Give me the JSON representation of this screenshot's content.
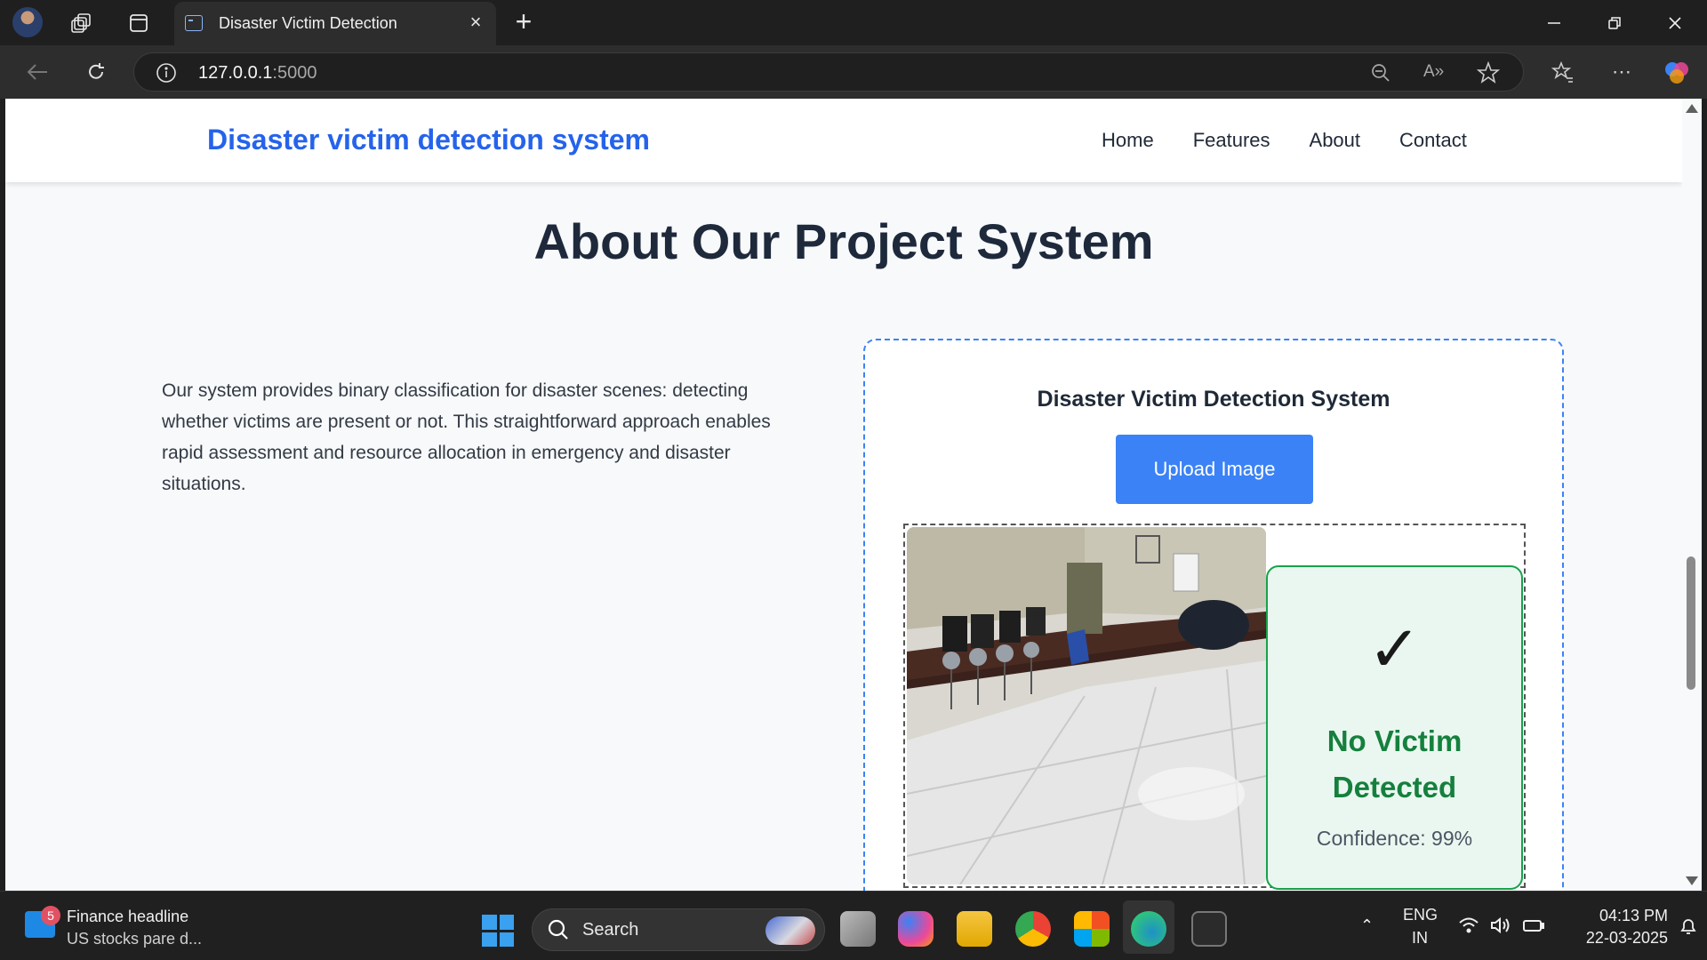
{
  "browser": {
    "tab_title": "Disaster Victim Detection",
    "url_host": "127.0.0.1",
    "url_port": ":5000"
  },
  "site": {
    "brand": "Disaster victim detection system",
    "nav": [
      "Home",
      "Features",
      "About",
      "Contact"
    ]
  },
  "about": {
    "heading": "About Our Project System",
    "description": "Our system provides binary classification for disaster scenes: detecting whether victims are present or not. This straightforward approach enables rapid assessment and resource allocation in emergency and disaster situations."
  },
  "demo": {
    "title": "Disaster Victim Detection System",
    "upload_label": "Upload Image",
    "result": {
      "check_symbol": "✓",
      "status": "No Victim Detected",
      "confidence": "Confidence: 99%"
    }
  },
  "taskbar": {
    "news_badge": "5",
    "news_title": "Finance headline",
    "news_subtitle": "US stocks pare d...",
    "search_label": "Search",
    "language": "ENG",
    "region": "IN",
    "time": "04:13 PM",
    "date": "22-03-2025"
  },
  "colors": {
    "brand": "#2563eb",
    "upload_button": "#3b82f6",
    "result_green": "#15803d"
  }
}
